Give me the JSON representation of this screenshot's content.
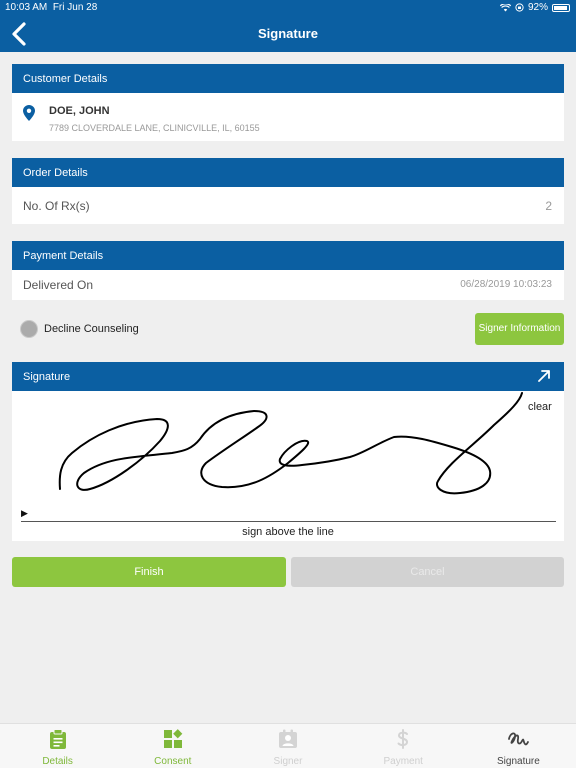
{
  "status": {
    "time": "10:03 AM",
    "date": "Fri Jun 28",
    "battery": "92%"
  },
  "nav": {
    "title": "Signature"
  },
  "customer": {
    "header": "Customer Details",
    "name": "DOE, JOHN",
    "address": "7789 CLOVERDALE LANE, CLINICVILLE, IL, 60155"
  },
  "order": {
    "header": "Order Details",
    "label": "No. Of Rx(s)",
    "value": "2"
  },
  "payment": {
    "header": "Payment Details",
    "label": "Delivered On",
    "value": "06/28/2019 10:03:23"
  },
  "decline": {
    "label": "Decline Counseling",
    "checked": false
  },
  "signer_button": "Signer Information",
  "signature": {
    "header": "Signature",
    "clear_label": "clear",
    "arrow": "▶",
    "hint": "sign above the line"
  },
  "actions": {
    "finish": "Finish",
    "cancel": "Cancel"
  },
  "tabs": [
    {
      "label": "Details",
      "icon": "clipboard-icon",
      "state": "done"
    },
    {
      "label": "Consent",
      "icon": "consent-icon",
      "state": "done"
    },
    {
      "label": "Signer",
      "icon": "signer-icon",
      "state": "disabled"
    },
    {
      "label": "Payment",
      "icon": "dollar-icon",
      "state": "disabled"
    },
    {
      "label": "Signature",
      "icon": "signature-icon",
      "state": "current"
    }
  ],
  "colors": {
    "brand_blue": "#0b5fa2",
    "accent_green": "#8dc63f",
    "disabled_gray": "#d2d2d2"
  }
}
